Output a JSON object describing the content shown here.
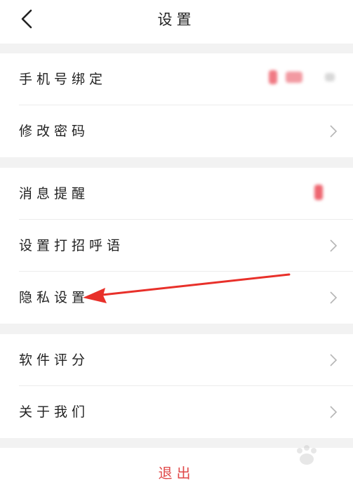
{
  "header": {
    "title": "设置"
  },
  "groups": [
    {
      "items": [
        {
          "label": "手机号绑定"
        },
        {
          "label": "修改密码"
        }
      ]
    },
    {
      "items": [
        {
          "label": "消息提醒"
        },
        {
          "label": "设置打招呼语"
        },
        {
          "label": "隐私设置"
        }
      ]
    },
    {
      "items": [
        {
          "label": "软件评分"
        },
        {
          "label": "关于我们"
        }
      ]
    }
  ],
  "logout": {
    "label": "退出"
  },
  "colors": {
    "accent": "#e04848",
    "arrow": "#e8302a"
  }
}
